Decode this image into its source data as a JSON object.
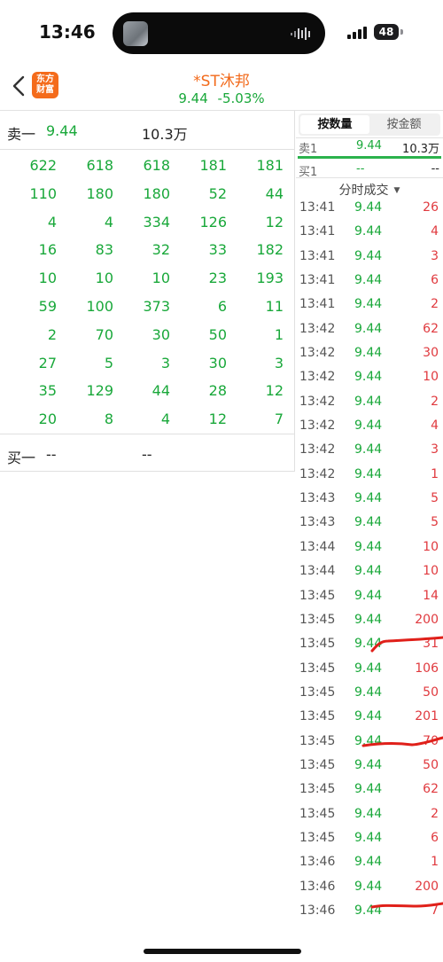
{
  "status_bar": {
    "time": "13:46",
    "battery": "48",
    "icons": [
      "signal-icon",
      "battery-icon",
      "audio-wave-icon"
    ]
  },
  "header": {
    "back_icon": "chevron-left-icon",
    "logo_line1": "东方",
    "logo_line2": "财富",
    "stock_name": "*ST沐邦",
    "price": "9.44",
    "change_pct": "-5.03%",
    "colors": {
      "down": "#19a83a",
      "up": "#e0393e",
      "name": "#f26a1b"
    }
  },
  "queue": {
    "sell_label": "卖一",
    "sell_price": "9.44",
    "sell_volume": "10.3万",
    "rows": [
      [
        "622",
        "618",
        "618",
        "181",
        "181"
      ],
      [
        "110",
        "180",
        "180",
        "52",
        "44"
      ],
      [
        "4",
        "4",
        "334",
        "126",
        "12"
      ],
      [
        "16",
        "83",
        "32",
        "33",
        "182"
      ],
      [
        "10",
        "10",
        "10",
        "23",
        "193"
      ],
      [
        "59",
        "100",
        "373",
        "6",
        "11"
      ],
      [
        "2",
        "70",
        "30",
        "50",
        "1"
      ],
      [
        "27",
        "5",
        "3",
        "30",
        "3"
      ],
      [
        "35",
        "129",
        "44",
        "28",
        "12"
      ],
      [
        "20",
        "8",
        "4",
        "12",
        "7"
      ]
    ],
    "buy_label": "买一",
    "buy_price": "--",
    "buy_volume": "--"
  },
  "right_panel": {
    "tab_quantity": "按数量",
    "tab_amount": "按金额",
    "sell1": {
      "label": "卖1",
      "price": "9.44",
      "volume": "10.3万"
    },
    "buy1": {
      "label": "买1",
      "price": "--",
      "volume": "--"
    },
    "trades_title": "分时成交",
    "trades": [
      {
        "time": "13:41",
        "price": "9.44",
        "volume": "26"
      },
      {
        "time": "13:41",
        "price": "9.44",
        "volume": "4"
      },
      {
        "time": "13:41",
        "price": "9.44",
        "volume": "3"
      },
      {
        "time": "13:41",
        "price": "9.44",
        "volume": "6"
      },
      {
        "time": "13:41",
        "price": "9.44",
        "volume": "2"
      },
      {
        "time": "13:42",
        "price": "9.44",
        "volume": "62"
      },
      {
        "time": "13:42",
        "price": "9.44",
        "volume": "30"
      },
      {
        "time": "13:42",
        "price": "9.44",
        "volume": "10"
      },
      {
        "time": "13:42",
        "price": "9.44",
        "volume": "2"
      },
      {
        "time": "13:42",
        "price": "9.44",
        "volume": "4"
      },
      {
        "time": "13:42",
        "price": "9.44",
        "volume": "3"
      },
      {
        "time": "13:42",
        "price": "9.44",
        "volume": "1"
      },
      {
        "time": "13:43",
        "price": "9.44",
        "volume": "5"
      },
      {
        "time": "13:43",
        "price": "9.44",
        "volume": "5"
      },
      {
        "time": "13:44",
        "price": "9.44",
        "volume": "10"
      },
      {
        "time": "13:44",
        "price": "9.44",
        "volume": "10"
      },
      {
        "time": "13:45",
        "price": "9.44",
        "volume": "14"
      },
      {
        "time": "13:45",
        "price": "9.44",
        "volume": "200"
      },
      {
        "time": "13:45",
        "price": "9.44",
        "volume": "31"
      },
      {
        "time": "13:45",
        "price": "9.44",
        "volume": "106"
      },
      {
        "time": "13:45",
        "price": "9.44",
        "volume": "50"
      },
      {
        "time": "13:45",
        "price": "9.44",
        "volume": "201"
      },
      {
        "time": "13:45",
        "price": "9.44",
        "volume": "70"
      },
      {
        "time": "13:45",
        "price": "9.44",
        "volume": "50"
      },
      {
        "time": "13:45",
        "price": "9.44",
        "volume": "62"
      },
      {
        "time": "13:45",
        "price": "9.44",
        "volume": "2"
      },
      {
        "time": "13:45",
        "price": "9.44",
        "volume": "6"
      },
      {
        "time": "13:46",
        "price": "9.44",
        "volume": "1"
      },
      {
        "time": "13:46",
        "price": "9.44",
        "volume": "200"
      },
      {
        "time": "13:46",
        "price": "9.44",
        "volume": "7"
      }
    ]
  }
}
